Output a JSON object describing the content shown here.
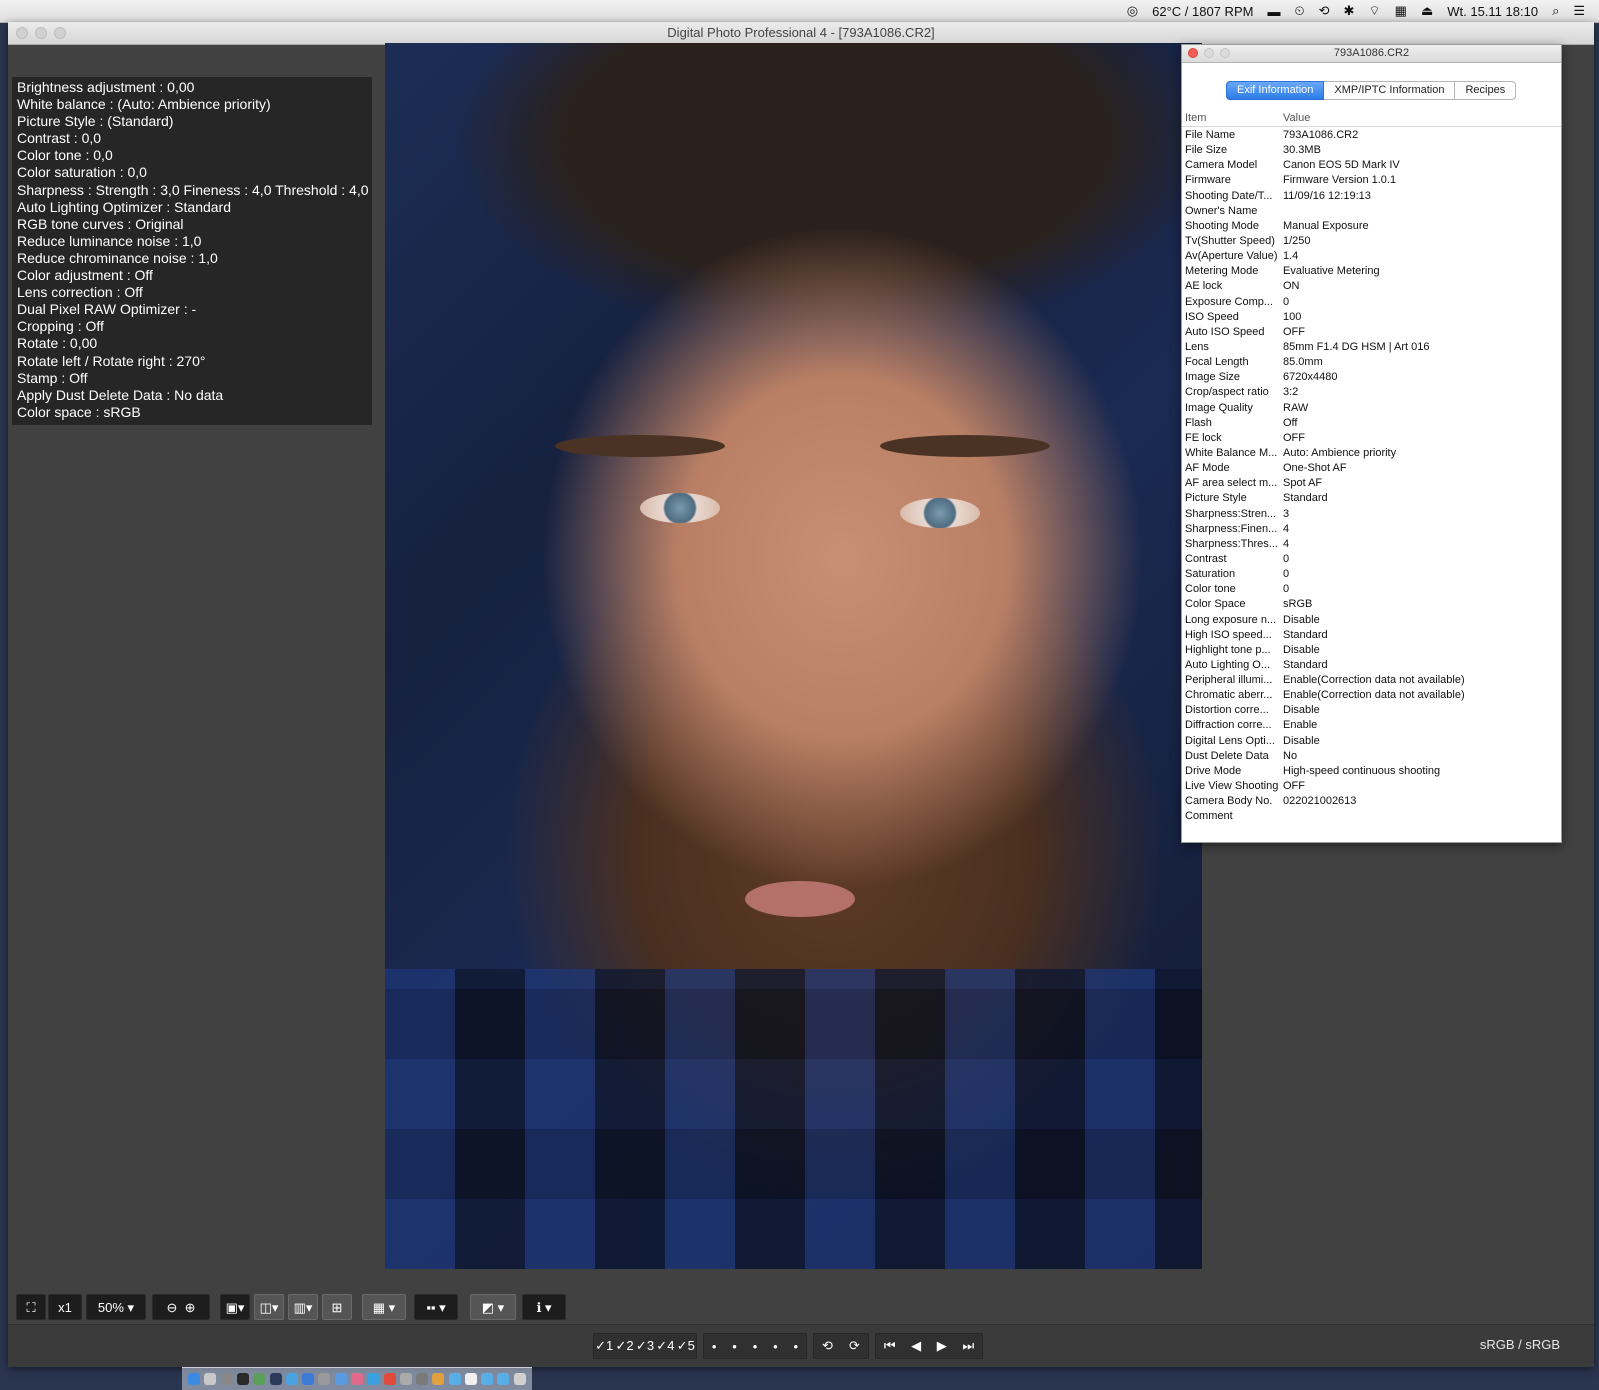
{
  "menubar": {
    "temp": "62°C / 1807 RPM",
    "datetime": "Wt. 15.11  18:10"
  },
  "window": {
    "title": "Digital Photo Professional 4 - [793A1086.CR2]"
  },
  "info_panel": {
    "lines": [
      "Brightness adjustment : 0,00",
      "White balance : (Auto: Ambience priority)",
      "Picture Style : (Standard)",
      "Contrast : 0,0",
      "Color tone : 0,0",
      "Color saturation : 0,0",
      "Sharpness : Strength : 3,0 Fineness : 4,0 Threshold : 4,0",
      "Auto Lighting Optimizer : Standard",
      "RGB tone curves : Original",
      "Reduce luminance noise : 1,0",
      "Reduce chrominance noise : 1,0",
      "Color adjustment  : Off",
      "Lens correction : Off",
      "Dual Pixel RAW Optimizer : -",
      "Cropping : Off",
      "Rotate : 0,00",
      "Rotate left / Rotate right : 270°",
      "Stamp : Off",
      "Apply Dust Delete Data : No data",
      "Color space : sRGB"
    ]
  },
  "exif_window": {
    "title": "793A1086.CR2",
    "tabs": [
      "Exif Information",
      "XMP/IPTC Information",
      "Recipes"
    ],
    "columns": [
      "Item",
      "Value"
    ],
    "rows": [
      [
        "File Name",
        "793A1086.CR2"
      ],
      [
        "File Size",
        "30.3MB"
      ],
      [
        "Camera Model",
        "Canon EOS 5D Mark IV"
      ],
      [
        "Firmware",
        "Firmware Version 1.0.1"
      ],
      [
        "Shooting Date/T...",
        "11/09/16 12:19:13"
      ],
      [
        "Owner's Name",
        ""
      ],
      [
        "Shooting Mode",
        "Manual Exposure"
      ],
      [
        "Tv(Shutter Speed)",
        "1/250"
      ],
      [
        "Av(Aperture Value)",
        "1.4"
      ],
      [
        "Metering Mode",
        "Evaluative Metering"
      ],
      [
        "AE lock",
        "ON"
      ],
      [
        "Exposure Comp...",
        "0"
      ],
      [
        "ISO Speed",
        "100"
      ],
      [
        "Auto ISO Speed",
        "OFF"
      ],
      [
        "Lens",
        "85mm F1.4 DG HSM | Art 016"
      ],
      [
        "Focal Length",
        "85.0mm"
      ],
      [
        "Image Size",
        "6720x4480"
      ],
      [
        "Crop/aspect ratio",
        "3:2"
      ],
      [
        "Image Quality",
        "RAW"
      ],
      [
        "Flash",
        "Off"
      ],
      [
        "FE lock",
        "OFF"
      ],
      [
        "White Balance M...",
        "Auto: Ambience priority"
      ],
      [
        "AF Mode",
        "One-Shot AF"
      ],
      [
        "AF area select m...",
        "Spot AF"
      ],
      [
        "Picture Style",
        "Standard"
      ],
      [
        "Sharpness:Stren...",
        "3"
      ],
      [
        "Sharpness:Finen...",
        "4"
      ],
      [
        "Sharpness:Thres...",
        "4"
      ],
      [
        "Contrast",
        "0"
      ],
      [
        "Saturation",
        "0"
      ],
      [
        "Color tone",
        "0"
      ],
      [
        "Color Space",
        "sRGB"
      ],
      [
        "Long exposure n...",
        "Disable"
      ],
      [
        "High ISO speed...",
        "Standard"
      ],
      [
        "Highlight tone p...",
        "Disable"
      ],
      [
        "Auto Lighting O...",
        "Standard"
      ],
      [
        "Peripheral illumi...",
        "Enable(Correction data not available)"
      ],
      [
        "Chromatic aberr...",
        "Enable(Correction data not available)"
      ],
      [
        "Distortion corre...",
        "Disable"
      ],
      [
        "Diffraction corre...",
        "Enable"
      ],
      [
        "Digital Lens Opti...",
        "Disable"
      ],
      [
        "Dust Delete Data",
        "No"
      ],
      [
        "Drive Mode",
        "High-speed continuous shooting"
      ],
      [
        "Live View Shooting",
        "OFF"
      ],
      [
        "Camera Body No.",
        "022021002613"
      ],
      [
        "Comment",
        ""
      ]
    ]
  },
  "toolbar": {
    "zoom_x1": "x1",
    "zoom_level": "50%",
    "rating_labels": [
      "1",
      "2",
      "3",
      "4",
      "5"
    ],
    "color_space": "sRGB / sRGB"
  },
  "colors": {
    "window_bg": "#414141",
    "info_bg": "#262626",
    "tab_active": "#2b7ce8"
  }
}
